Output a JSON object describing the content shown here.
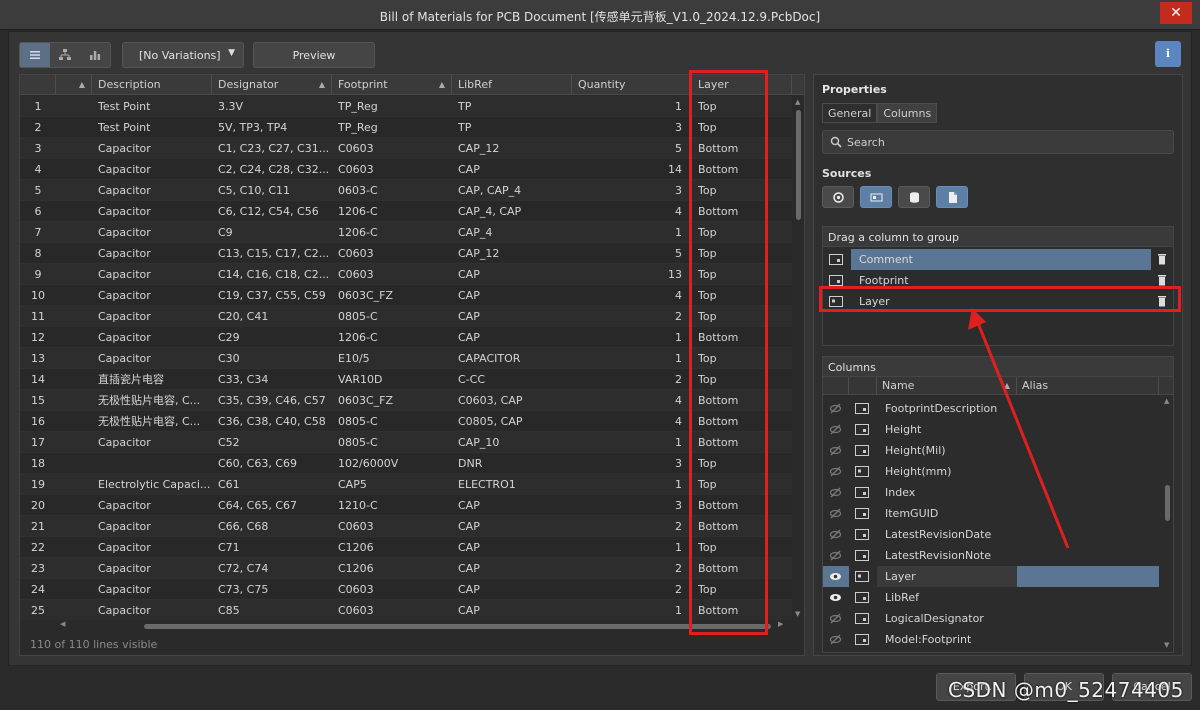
{
  "window": {
    "title": "Bill of Materials for PCB Document [传感单元背板_V1.0_2024.12.9.PcbDoc]",
    "close_glyph": "✕"
  },
  "toolbar": {
    "view_icons": [
      "list-view-icon",
      "tree-view-icon",
      "chart-view-icon"
    ],
    "variations_label": "[No Variations]",
    "preview_label": "Preview",
    "info_label": "i"
  },
  "grid": {
    "headers": [
      "",
      "Description",
      "Designator",
      "Footprint",
      "LibRef",
      "Quantity",
      "Layer"
    ],
    "rows": [
      [
        "1",
        "Test Point",
        "3.3V",
        "TP_Reg",
        "TP",
        "1",
        "Top"
      ],
      [
        "2",
        "Test Point",
        "5V, TP3, TP4",
        "TP_Reg",
        "TP",
        "3",
        "Top"
      ],
      [
        "3",
        "Capacitor",
        "C1, C23, C27, C31...",
        "C0603",
        "CAP_12",
        "5",
        "Bottom"
      ],
      [
        "4",
        "Capacitor",
        "C2, C24, C28, C32...",
        "C0603",
        "CAP",
        "14",
        "Bottom"
      ],
      [
        "5",
        "Capacitor",
        "C5, C10, C11",
        "0603-C",
        "CAP, CAP_4",
        "3",
        "Top"
      ],
      [
        "6",
        "Capacitor",
        "C6, C12, C54, C56",
        "1206-C",
        "CAP_4, CAP",
        "4",
        "Bottom"
      ],
      [
        "7",
        "Capacitor",
        "C9",
        "1206-C",
        "CAP_4",
        "1",
        "Top"
      ],
      [
        "8",
        "Capacitor",
        "C13, C15, C17, C2...",
        "C0603",
        "CAP_12",
        "5",
        "Top"
      ],
      [
        "9",
        "Capacitor",
        "C14, C16, C18, C2...",
        "C0603",
        "CAP",
        "13",
        "Top"
      ],
      [
        "10",
        "Capacitor",
        "C19, C37, C55, C59",
        "0603C_FZ",
        "CAP",
        "4",
        "Top"
      ],
      [
        "11",
        "Capacitor",
        "C20, C41",
        "0805-C",
        "CAP",
        "2",
        "Top"
      ],
      [
        "12",
        "Capacitor",
        "C29",
        "1206-C",
        "CAP",
        "1",
        "Bottom"
      ],
      [
        "13",
        "Capacitor",
        "C30",
        "E10/5",
        "CAPACITOR",
        "1",
        "Top"
      ],
      [
        "14",
        "直插瓷片电容",
        "C33, C34",
        "VAR10D",
        "C-CC",
        "2",
        "Top"
      ],
      [
        "15",
        "无极性贴片电容, C...",
        "C35, C39, C46, C57",
        "0603C_FZ",
        "C0603, CAP",
        "4",
        "Bottom"
      ],
      [
        "16",
        "无极性贴片电容, C...",
        "C36, C38, C40, C58",
        "0805-C",
        "C0805, CAP",
        "4",
        "Bottom"
      ],
      [
        "17",
        "Capacitor",
        "C52",
        "0805-C",
        "CAP_10",
        "1",
        "Bottom"
      ],
      [
        "18",
        "",
        "C60, C63, C69",
        "102/6000V",
        "DNR",
        "3",
        "Top"
      ],
      [
        "19",
        "Electrolytic Capaci...",
        "C61",
        "CAP5",
        "ELECTRO1",
        "1",
        "Top"
      ],
      [
        "20",
        "Capacitor",
        "C64, C65, C67",
        "1210-C",
        "CAP",
        "3",
        "Bottom"
      ],
      [
        "21",
        "Capacitor",
        "C66, C68",
        "C0603",
        "CAP",
        "2",
        "Bottom"
      ],
      [
        "22",
        "Capacitor",
        "C71",
        "C1206",
        "CAP",
        "1",
        "Top"
      ],
      [
        "23",
        "Capacitor",
        "C72, C74",
        "C1206",
        "CAP",
        "2",
        "Bottom"
      ],
      [
        "24",
        "Capacitor",
        "C73, C75",
        "C0603",
        "CAP",
        "2",
        "Top"
      ],
      [
        "25",
        "Capacitor",
        "C85",
        "C0603",
        "CAP",
        "1",
        "Bottom"
      ]
    ],
    "status": "110 of 110 lines visible"
  },
  "properties": {
    "title": "Properties",
    "tabs": [
      "General",
      "Columns"
    ],
    "search_placeholder": "Search",
    "sources_label": "Sources",
    "group_panel": {
      "header": "Drag a column to group",
      "items": [
        "Comment",
        "Footprint",
        "Layer"
      ]
    },
    "columns_panel": {
      "header": "Columns",
      "name_header": "Name",
      "alias_header": "Alias",
      "items": [
        {
          "name": "FootprintDescription",
          "visible": false
        },
        {
          "name": "Height",
          "visible": false
        },
        {
          "name": "Height(Mil)",
          "visible": false
        },
        {
          "name": "Height(mm)",
          "visible": false
        },
        {
          "name": "Index",
          "visible": false
        },
        {
          "name": "ItemGUID",
          "visible": false
        },
        {
          "name": "LatestRevisionDate",
          "visible": false
        },
        {
          "name": "LatestRevisionNote",
          "visible": false
        },
        {
          "name": "Layer",
          "visible": true
        },
        {
          "name": "LibRef",
          "visible": true
        },
        {
          "name": "LogicalDesignator",
          "visible": false
        },
        {
          "name": "Model:Footprint",
          "visible": false
        }
      ]
    }
  },
  "footer": {
    "buttons": [
      "Export...",
      "OK",
      "Cancel"
    ]
  },
  "watermark": "CSDN @m0_52474405",
  "colors": {
    "highlight_red": "#e02020",
    "selection_blue": "#5a7694",
    "close_red": "#c42b1c"
  }
}
